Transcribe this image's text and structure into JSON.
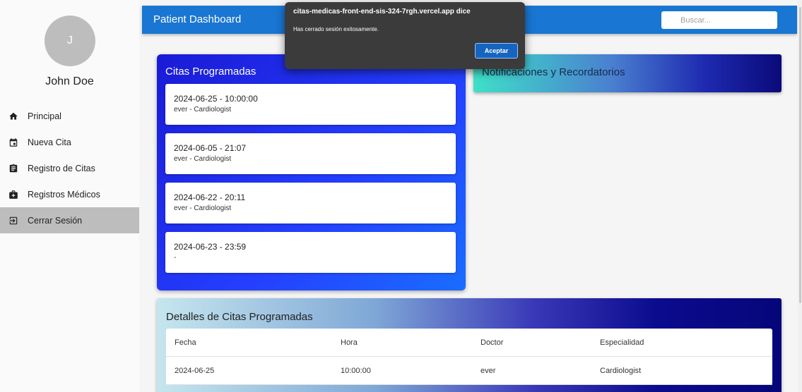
{
  "sidebar": {
    "avatar_initial": "J",
    "user_name": "John Doe",
    "items": [
      {
        "label": "Principal",
        "icon": "home-icon"
      },
      {
        "label": "Nueva Cita",
        "icon": "calendar-icon"
      },
      {
        "label": "Registro de Citas",
        "icon": "clipboard-icon"
      },
      {
        "label": "Registros Médicos",
        "icon": "medical-kit-icon"
      },
      {
        "label": "Cerrar Sesión",
        "icon": "logout-icon",
        "active": true
      }
    ]
  },
  "header": {
    "title": "Patient Dashboard",
    "search_placeholder": "Buscar...",
    "color": "#1976d2"
  },
  "citas": {
    "title": "Citas Programadas",
    "items": [
      {
        "datetime": "2024-06-25 - 10:00:00",
        "doctor": "ever - Cardiologist"
      },
      {
        "datetime": "2024-06-05 - 21:07",
        "doctor": "ever - Cardiologist"
      },
      {
        "datetime": "2024-06-22 - 20:11",
        "doctor": "ever - Cardiologist"
      },
      {
        "datetime": "2024-06-23 - 23:59",
        "doctor": "-"
      }
    ]
  },
  "notificaciones": {
    "title": "Notificaciones y Recordatorios"
  },
  "detalles": {
    "title": "Detalles de Citas Programadas",
    "columns": [
      "Fecha",
      "Hora",
      "Doctor",
      "Especialidad"
    ],
    "rows": [
      [
        "2024-06-25",
        "10:00:00",
        "ever",
        "Cardiologist"
      ]
    ]
  },
  "dialog": {
    "title": "citas-medicas-front-end-sis-324-7rgh.vercel.app dice",
    "message": "Has cerrado sesión exitosamente.",
    "button": "Aceptar"
  }
}
